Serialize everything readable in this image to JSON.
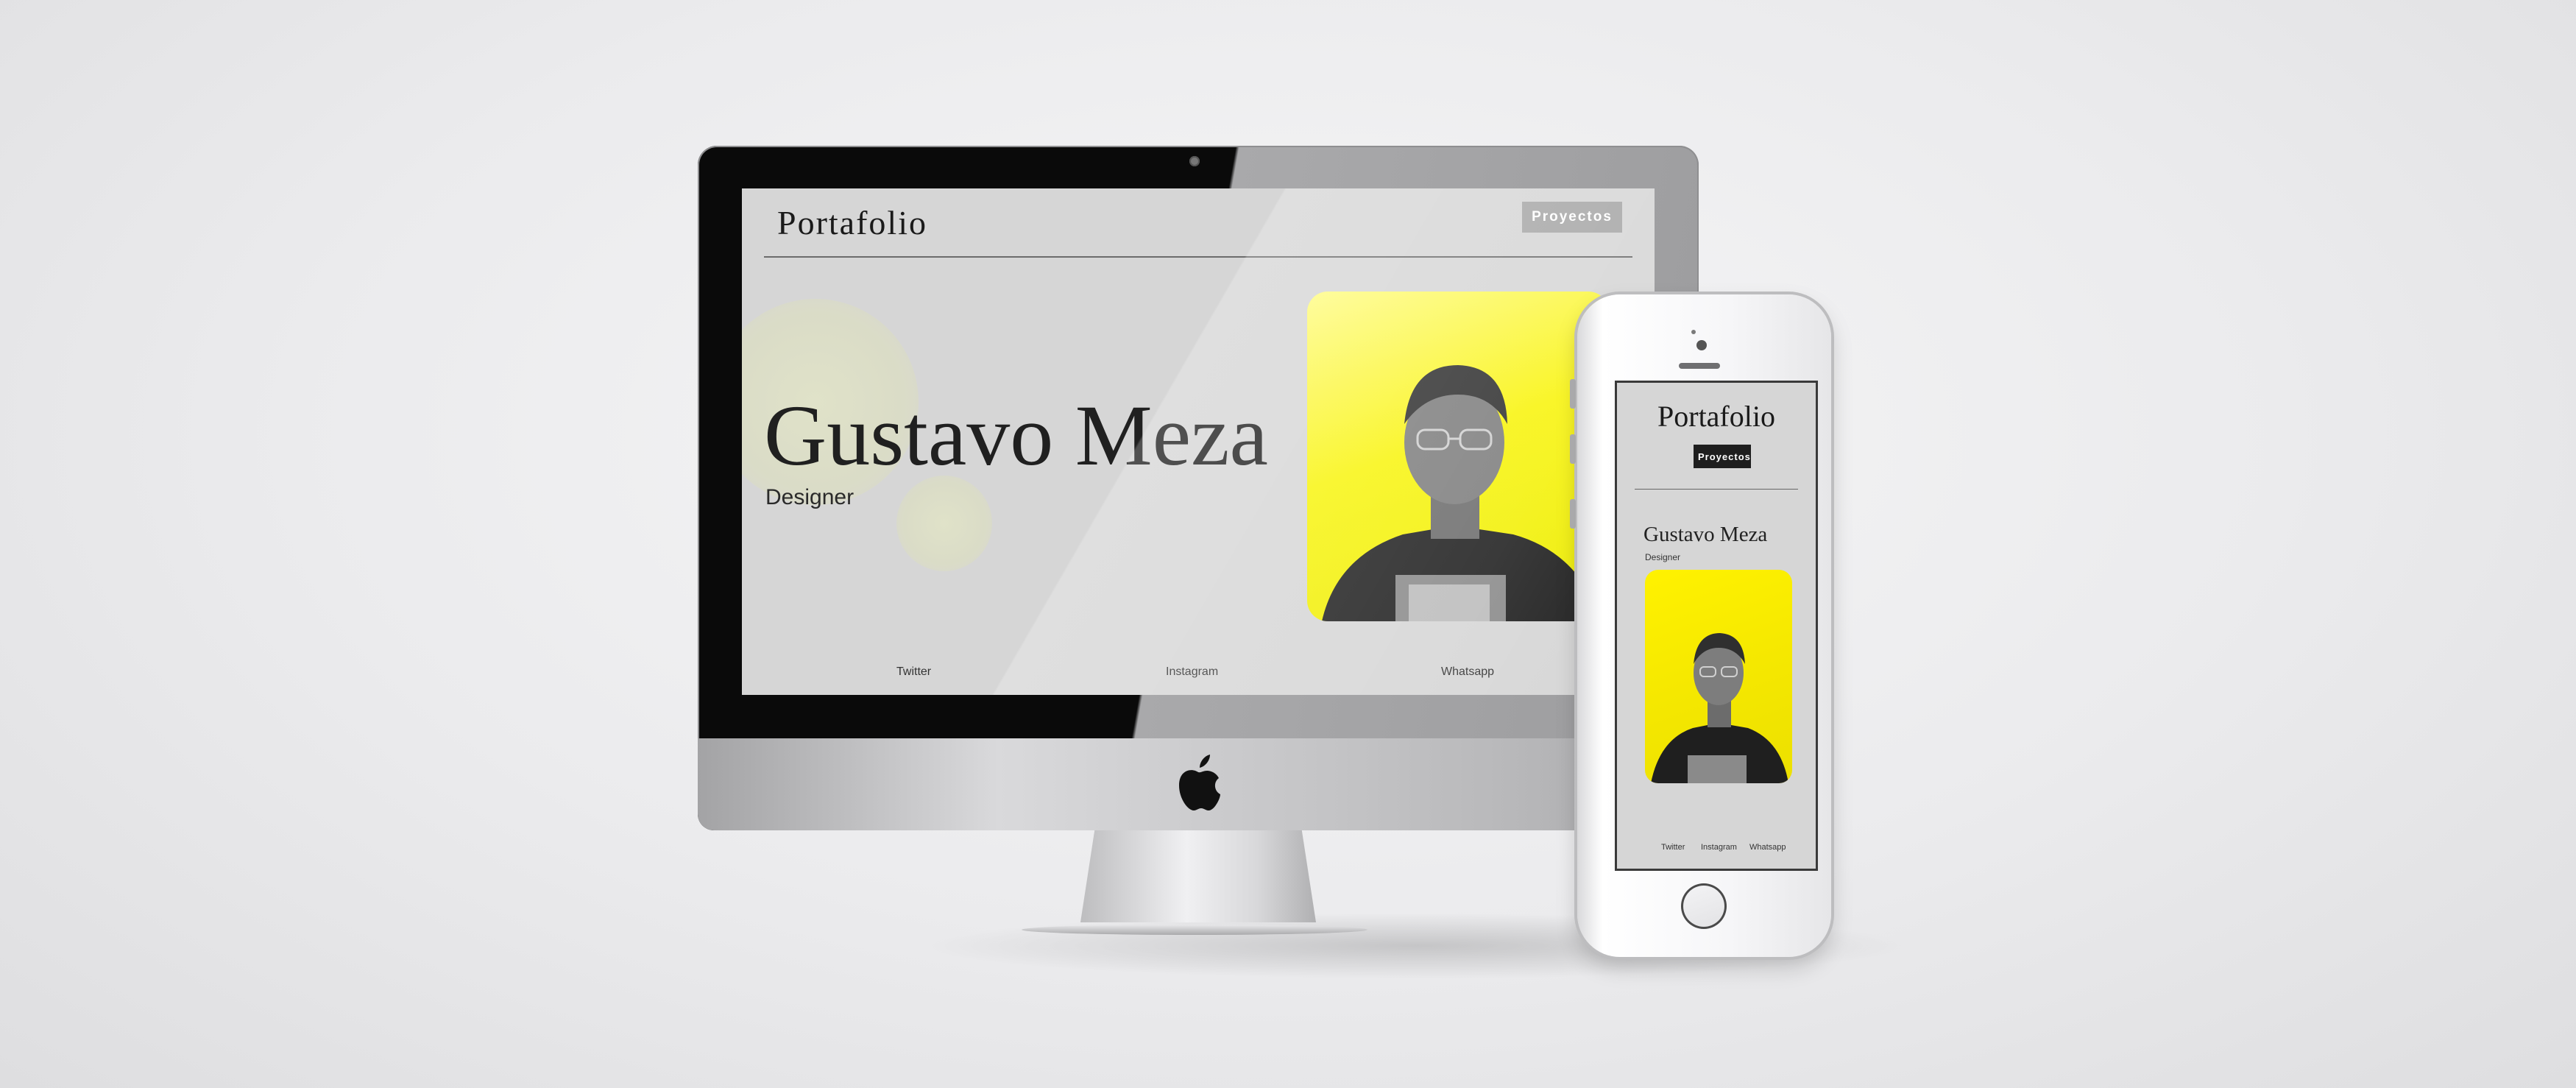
{
  "desktop": {
    "brand": "Portafolio",
    "nav_button_label": "Proyectos",
    "hero": {
      "name": "Gustavo Meza",
      "role": "Designer"
    },
    "socials": [
      "Twitter",
      "Instagram",
      "Whatsapp"
    ]
  },
  "mobile": {
    "brand": "Portafolio",
    "nav_button_label": "Proyectos",
    "hero": {
      "name": "Gustavo Meza",
      "role": "Designer"
    },
    "socials": [
      "Twitter",
      "Instagram",
      "Whatsapp"
    ]
  },
  "icons": [
    "apple-icon"
  ],
  "colors": {
    "accent_yellow": "#F5F000",
    "page_background": "#D6D6D6",
    "nav_button_desktop": "#A7A7A7",
    "nav_button_mobile": "#1E1E1E"
  }
}
